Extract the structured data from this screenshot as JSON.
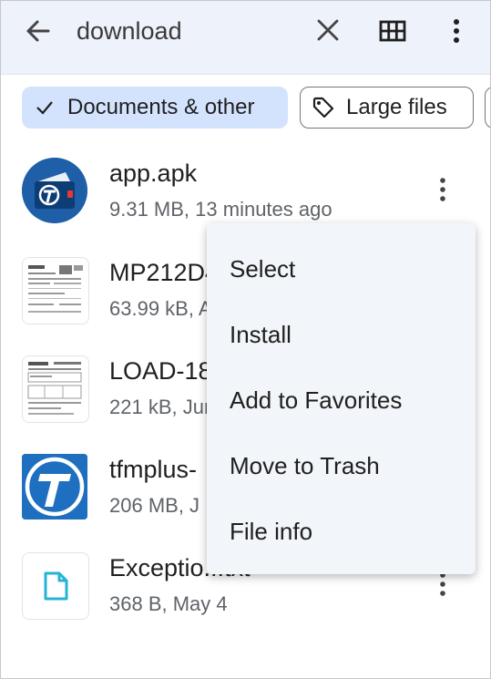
{
  "search": {
    "query": "download"
  },
  "icons": {
    "back": "arrow-left-icon",
    "clear": "close-icon",
    "view": "grid-view-icon",
    "more": "more-vertical-icon"
  },
  "chips": {
    "docs": {
      "label": "Documents & other",
      "selected": true
    },
    "large": {
      "label": "Large files"
    }
  },
  "files": [
    {
      "name": "app.apk",
      "meta": "9.31 MB, 13 minutes ago"
    },
    {
      "name": "MP212D4",
      "meta": "63.99 kB, A"
    },
    {
      "name": "LOAD-18",
      "meta": "221 kB, Jun"
    },
    {
      "name": "tfmplus-",
      "meta": "206 MB, J"
    },
    {
      "name": "Exceptio...txt",
      "meta": "368 B, May 4"
    }
  ],
  "menu": {
    "items": [
      "Select",
      "Install",
      "Add to Favorites",
      "Move to Trash",
      "File info"
    ]
  },
  "colors": {
    "accent": "#1a73e8",
    "selected_chip": "#d3e3fd",
    "topbar": "#eef2fb",
    "app_icon_bg": "#1e5fa8",
    "txt_icon": "#24b4d6"
  }
}
